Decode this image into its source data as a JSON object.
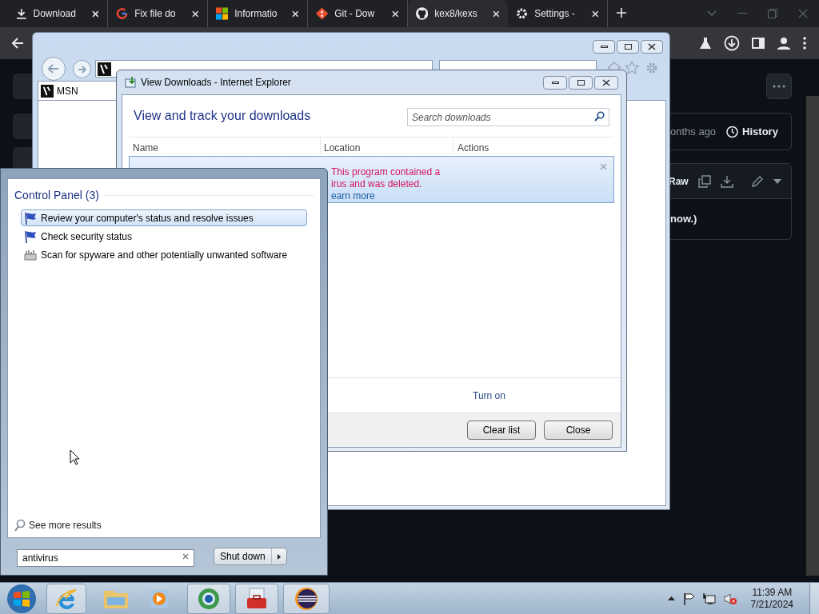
{
  "browser": {
    "tabs": [
      {
        "kind": "download",
        "label": "Download",
        "selected": false
      },
      {
        "kind": "google",
        "label": "Fix file do",
        "selected": false
      },
      {
        "kind": "windows",
        "label": "Informatio",
        "selected": false
      },
      {
        "kind": "git",
        "label": "Git - Dow",
        "selected": false
      },
      {
        "kind": "github",
        "label": "kex8/kexs",
        "selected": true
      },
      {
        "kind": "gear",
        "label": "Settings -",
        "selected": false
      }
    ]
  },
  "github": {
    "updated": "onths ago",
    "history": "History",
    "raw": "Raw",
    "content": "now.)"
  },
  "ie_window": {
    "tab": "MSN"
  },
  "downloads_dialog": {
    "title": "View Downloads - Internet Explorer",
    "heading": "View and track your downloads",
    "search": {
      "placeholder": "Search downloads"
    },
    "columns": [
      "Name",
      "Location",
      "Actions"
    ],
    "message_lines": [
      "This program contained a",
      "irus and was deleted."
    ],
    "link": "earn more",
    "footer_link": "Turn on",
    "buttons": [
      "Clear list",
      "Close"
    ]
  },
  "start_menu": {
    "group": "Control Panel (3)",
    "items": [
      {
        "kind": "flag",
        "label": "Review your computer's status and resolve issues",
        "selected": true
      },
      {
        "kind": "flag",
        "label": "Check security status",
        "selected": false
      },
      {
        "kind": "scan",
        "label": "Scan for spyware and other potentially unwanted software",
        "selected": false
      }
    ],
    "more": "See more results",
    "search": {
      "value": "antivirus"
    },
    "shutdown": "Shut down"
  },
  "taskbar": {
    "time": "11:39 AM",
    "date": "7/21/2024"
  }
}
